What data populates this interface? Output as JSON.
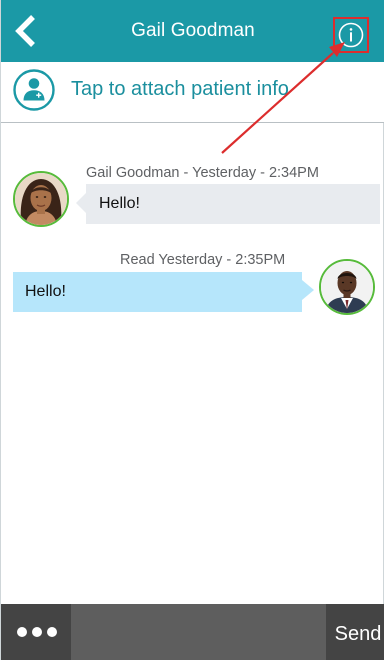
{
  "header": {
    "title": "Gail Goodman"
  },
  "attach": {
    "label": "Tap to attach patient info"
  },
  "messages": [
    {
      "direction": "incoming",
      "meta": "Gail Goodman - Yesterday - 2:34PM",
      "text": "Hello!"
    },
    {
      "direction": "outgoing",
      "meta": "Read Yesterday - 2:35PM",
      "text": "Hello!"
    }
  ],
  "composer": {
    "value": "",
    "placeholder": "",
    "send_label": "Send"
  },
  "icons": {
    "back": "chevron-left-icon",
    "info": "info-circle-icon",
    "patient": "patient-icon",
    "more": "more-dots-icon"
  },
  "colors": {
    "header": "#1b99a6",
    "accent_text": "#1b8f9e",
    "incoming_bubble": "#e8ebef",
    "outgoing_bubble": "#b6e6fb",
    "avatar_ring": "#57bb3b",
    "bottom_bar": "#444444",
    "annotation": "#dc2d2d"
  }
}
